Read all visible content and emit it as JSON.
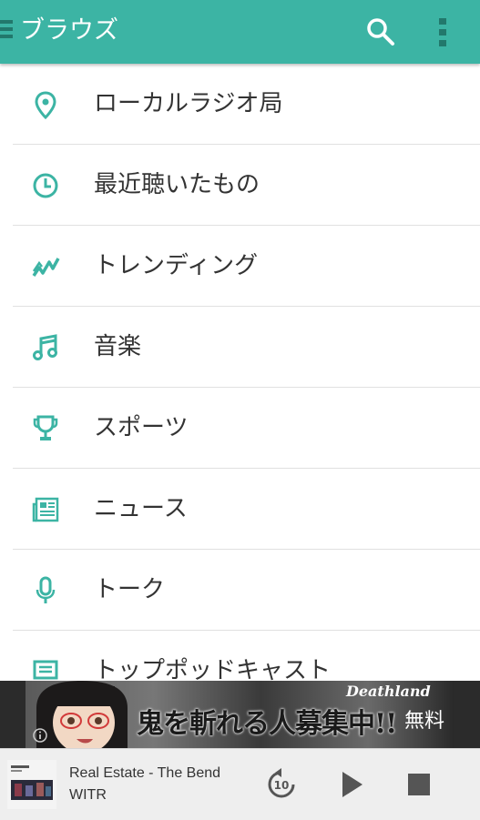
{
  "app_bar": {
    "title": "ブラウズ",
    "background": "#3cb4a4",
    "icons": [
      "drawer-icon",
      "search-icon",
      "more-vert-icon"
    ]
  },
  "browse_list": {
    "accent": "#3cb4a4",
    "items": [
      {
        "icon": "location-pin-icon",
        "label": "ローカルラジオ局"
      },
      {
        "icon": "clock-icon",
        "label": "最近聴いたもの"
      },
      {
        "icon": "trending-icon",
        "label": "トレンディング"
      },
      {
        "icon": "music-note-icon",
        "label": "音楽"
      },
      {
        "icon": "trophy-icon",
        "label": "スポーツ"
      },
      {
        "icon": "newspaper-icon",
        "label": "ニュース"
      },
      {
        "icon": "microphone-icon",
        "label": "トーク"
      },
      {
        "icon": "podcast-icon",
        "label": "トップポッドキャスト"
      }
    ]
  },
  "ad_banner": {
    "headline": "鬼を斬れる人募集中!!",
    "brand": "Deathland",
    "badge": "無料"
  },
  "now_playing": {
    "track": "Real Estate - The Bend",
    "station": "WITR",
    "rewind_seconds": "10"
  }
}
